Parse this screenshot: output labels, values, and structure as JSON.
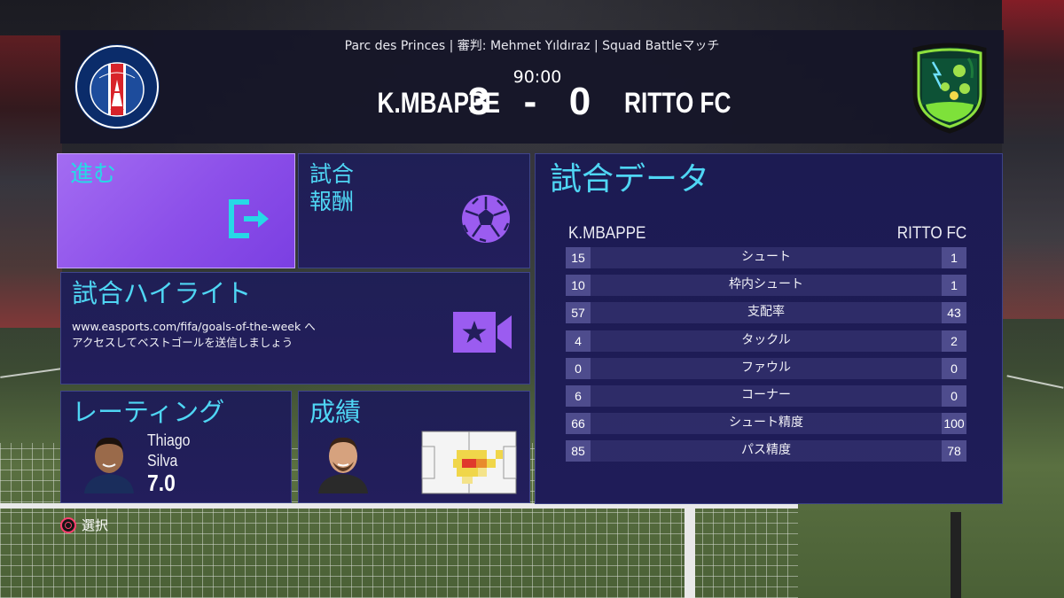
{
  "header": {
    "venue_line": "Parc des Princes | 審判: Mehmet Yıldıraz | Squad Battleマッチ",
    "clock": "90:00",
    "home_team": "K.MBAPPE",
    "away_team": "RITTO FC",
    "home_score": "3",
    "separator": "-",
    "away_score": "0",
    "home_crest_text_top": "PARIS",
    "home_crest_text_bottom": "SAINT-GERMAIN"
  },
  "tiles": {
    "proceed": {
      "title": "進む",
      "icon": "exit-arrow-icon"
    },
    "rewards": {
      "title_line1": "試合",
      "title_line2": "報酬",
      "icon": "football-icon"
    },
    "highlights": {
      "title": "試合ハイライト",
      "text_line1": "www.easports.com/fifa/goals-of-the-week へ",
      "text_line2": "アクセスしてベストゴールを送信しましょう",
      "icon": "video-camera-star-icon"
    },
    "rating": {
      "title": "レーティング",
      "player_first": "Thiago",
      "player_last": "Silva",
      "value": "7.0"
    },
    "stats": {
      "title": "成績",
      "icon": "heatmap-pitch-icon"
    }
  },
  "match_data": {
    "title": "試合データ",
    "home_label": "K.MBAPPE",
    "away_label": "RITTO FC",
    "rows": [
      {
        "home": "15",
        "label": "シュート",
        "away": "1"
      },
      {
        "home": "10",
        "label": "枠内シュート",
        "away": "1"
      },
      {
        "home": "57",
        "label": "支配率",
        "away": "43"
      },
      {
        "home": "4",
        "label": "タックル",
        "away": "2"
      },
      {
        "home": "0",
        "label": "ファウル",
        "away": "0"
      },
      {
        "home": "6",
        "label": "コーナー",
        "away": "0"
      },
      {
        "home": "66",
        "label": "シュート精度",
        "away": "100"
      },
      {
        "home": "85",
        "label": "パス精度",
        "away": "78"
      }
    ]
  },
  "footer": {
    "select_label": "選択",
    "button_icon": "circle-button-icon"
  },
  "colors": {
    "accent_cyan": "#4fd6f4",
    "proceed_purple": "#8c4fe9",
    "panel": "#1f1f55"
  }
}
